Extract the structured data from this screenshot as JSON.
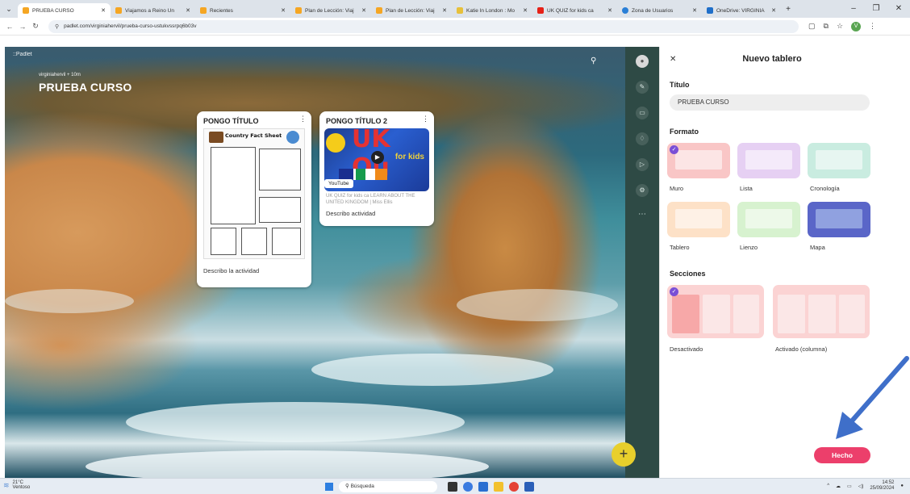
{
  "browser": {
    "tabs": [
      {
        "label": "PRUEBA CURSO",
        "active": true,
        "favicon_color": "#f5a623"
      },
      {
        "label": "Viajamos a Reino Un",
        "active": false,
        "favicon_color": "#f5a623"
      },
      {
        "label": "Recientes",
        "active": false,
        "favicon_color": "#f5a623"
      },
      {
        "label": "Plan de Lección: Viaj",
        "active": false,
        "favicon_color": "#f5a623"
      },
      {
        "label": "Plan de Lección: Viaj",
        "active": false,
        "favicon_color": "#f5a623"
      },
      {
        "label": "Katie In London : Mo",
        "active": false,
        "favicon_color": "#e7c03a"
      },
      {
        "label": "UK QUIZ for kids ca",
        "active": false,
        "favicon_color": "#e62117"
      },
      {
        "label": "Zona de Usuarios",
        "active": false,
        "favicon_color": "#2a7fd6"
      },
      {
        "label": "OneDrive: VIRGINIA",
        "active": false,
        "favicon_color": "#1f6fc9"
      }
    ],
    "url": "padlet.com/virginiahervil/prueba-curso-ustukvssrpq6b03v",
    "profile_initial": "V"
  },
  "board": {
    "logo": "::Padlet",
    "author": "virginiahervil + 10m",
    "title": "PRUEBA CURSO",
    "posts": [
      {
        "title": "PONGO TÍTULO",
        "worksheet_heading": "Country Fact Sheet",
        "description": "Describo la actividad"
      },
      {
        "title": "PONGO TÍTULO 2",
        "thumb_text": "UK Qu",
        "thumb_kids": "for kids",
        "badge": "YouTube",
        "link_text": "UK QUIZ for kids ca LEARN ABOUT THE UNITED KINGDOM | Miss Ellis",
        "description": "Describo actividad"
      }
    ]
  },
  "panel": {
    "title": "Nuevo tablero",
    "title_label": "Título",
    "title_value": "PRUEBA CURSO",
    "format_label": "Formato",
    "formats": [
      {
        "label": "Muro",
        "selected": true,
        "color": "#f9c6c6"
      },
      {
        "label": "Lista",
        "selected": false,
        "color": "#e6d0f3"
      },
      {
        "label": "Cronología",
        "selected": false,
        "color": "#c9ece0"
      },
      {
        "label": "Tablero",
        "selected": false,
        "color": "#fde1c7"
      },
      {
        "label": "Lienzo",
        "selected": false,
        "color": "#d7f2cf"
      },
      {
        "label": "Mapa",
        "selected": false,
        "color": "#5a66c8"
      }
    ],
    "sections_label": "Secciones",
    "sections": [
      {
        "label": "Desactivado",
        "selected": true
      },
      {
        "label": "Activado (columna)",
        "selected": false
      }
    ],
    "done_label": "Hecho"
  },
  "taskbar": {
    "weather_temp": "21°C",
    "weather_desc": "Ventoso",
    "search_placeholder": "Búsqueda",
    "time": "14:52",
    "date": "25/09/2024"
  },
  "colors": {
    "accent_done": "#ec3f6b",
    "rail": "#2e4a45",
    "fab": "#e8cf2c",
    "selected_check": "#7a4fd6",
    "arrow": "#3f6fc9"
  }
}
